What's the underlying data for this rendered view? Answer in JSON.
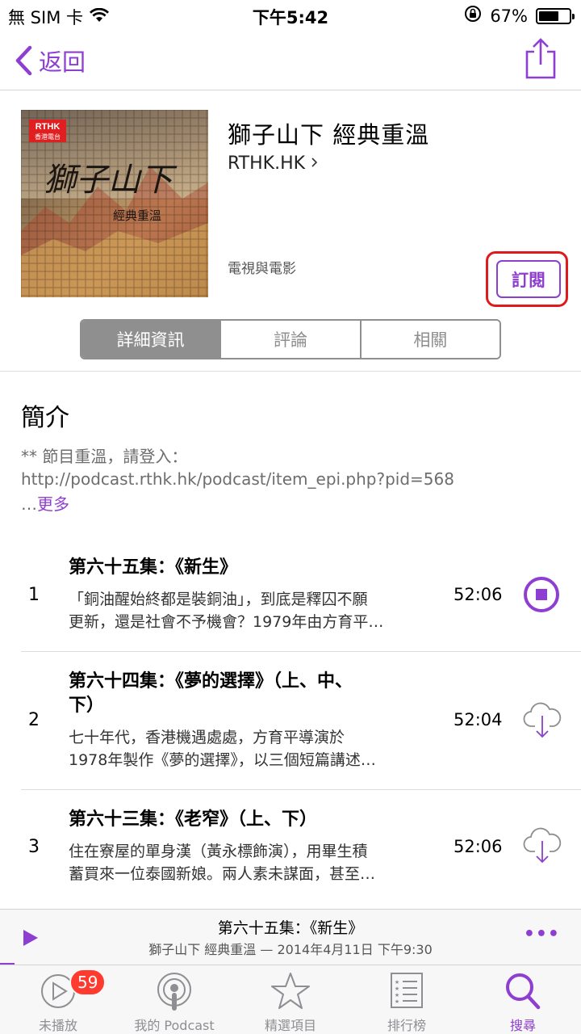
{
  "status_bar": {
    "carrier": "無 SIM 卡",
    "time": "下午5:42",
    "battery_percent": "67%",
    "battery_level": 0.67
  },
  "nav": {
    "back_label": "返回",
    "share_icon": "share-icon"
  },
  "podcast": {
    "title": "獅子山下  經典重溫",
    "author": "RTHK.HK",
    "category": "電視與電影",
    "subscribe_label": "訂閱",
    "artwork": {
      "badge_line1": "RTHK",
      "badge_line2": "香港電台",
      "calligraphy": "獅子山下",
      "subtitle": "經典重溫"
    }
  },
  "segments": {
    "items": [
      "詳細資訊",
      "評論",
      "相關"
    ],
    "selected_index": 0
  },
  "description": {
    "heading": "簡介",
    "text": "** 節目重溫，請登入：http://podcast.rthk.hk/podcast/item_epi.php?pid=568",
    "ellipsis": "…",
    "more_label": "更多"
  },
  "episodes": [
    {
      "number": "1",
      "title": "第六十五集：《新生》",
      "description_line1": "「銅油醒始終都是裝銅油」，到底是釋囚不願",
      "description_line2": "更新，還是社會不予機會？1979年由方育平…",
      "duration": "52:06",
      "action_icon": "stop-download-icon"
    },
    {
      "number": "2",
      "title_line1": "第六十四集：《夢的選擇》（上、中、",
      "title_line2": "下）",
      "description_line1": "七十年代，香港機遇處處，方育平導演於",
      "description_line2": "1978年製作《夢的選擇》，以三個短篇講述…",
      "duration": "52:04",
      "action_icon": "cloud-download-icon"
    },
    {
      "number": "3",
      "title": "第六十三集：《老窄》（上、下）",
      "description_line1": "住在寮屋的單身漢（黃永標飾演），用畢生積",
      "description_line2": "蓄買來一位泰國新娘。兩人素未謀面，甚至…",
      "duration": "52:06",
      "action_icon": "cloud-download-icon"
    }
  ],
  "mini_player": {
    "title": "第六十五集：《新生》",
    "subtitle": "獅子山下  經典重溫 — 2014年4月11日 下午9:30",
    "more_label": "•••"
  },
  "tab_bar": {
    "items": [
      {
        "label": "未播放",
        "icon": "play-circle-icon",
        "badge": "59"
      },
      {
        "label": "我的 Podcast",
        "icon": "podcast-icon"
      },
      {
        "label": "精選項目",
        "icon": "star-icon"
      },
      {
        "label": "排行榜",
        "icon": "list-icon"
      },
      {
        "label": "搜尋",
        "icon": "search-icon"
      }
    ],
    "selected_index": 4
  },
  "colors": {
    "accent": "#8e3ed0",
    "highlight_box": "#e0191b",
    "badge": "#ff3b30",
    "segment_selected": "#8f8f8f"
  }
}
